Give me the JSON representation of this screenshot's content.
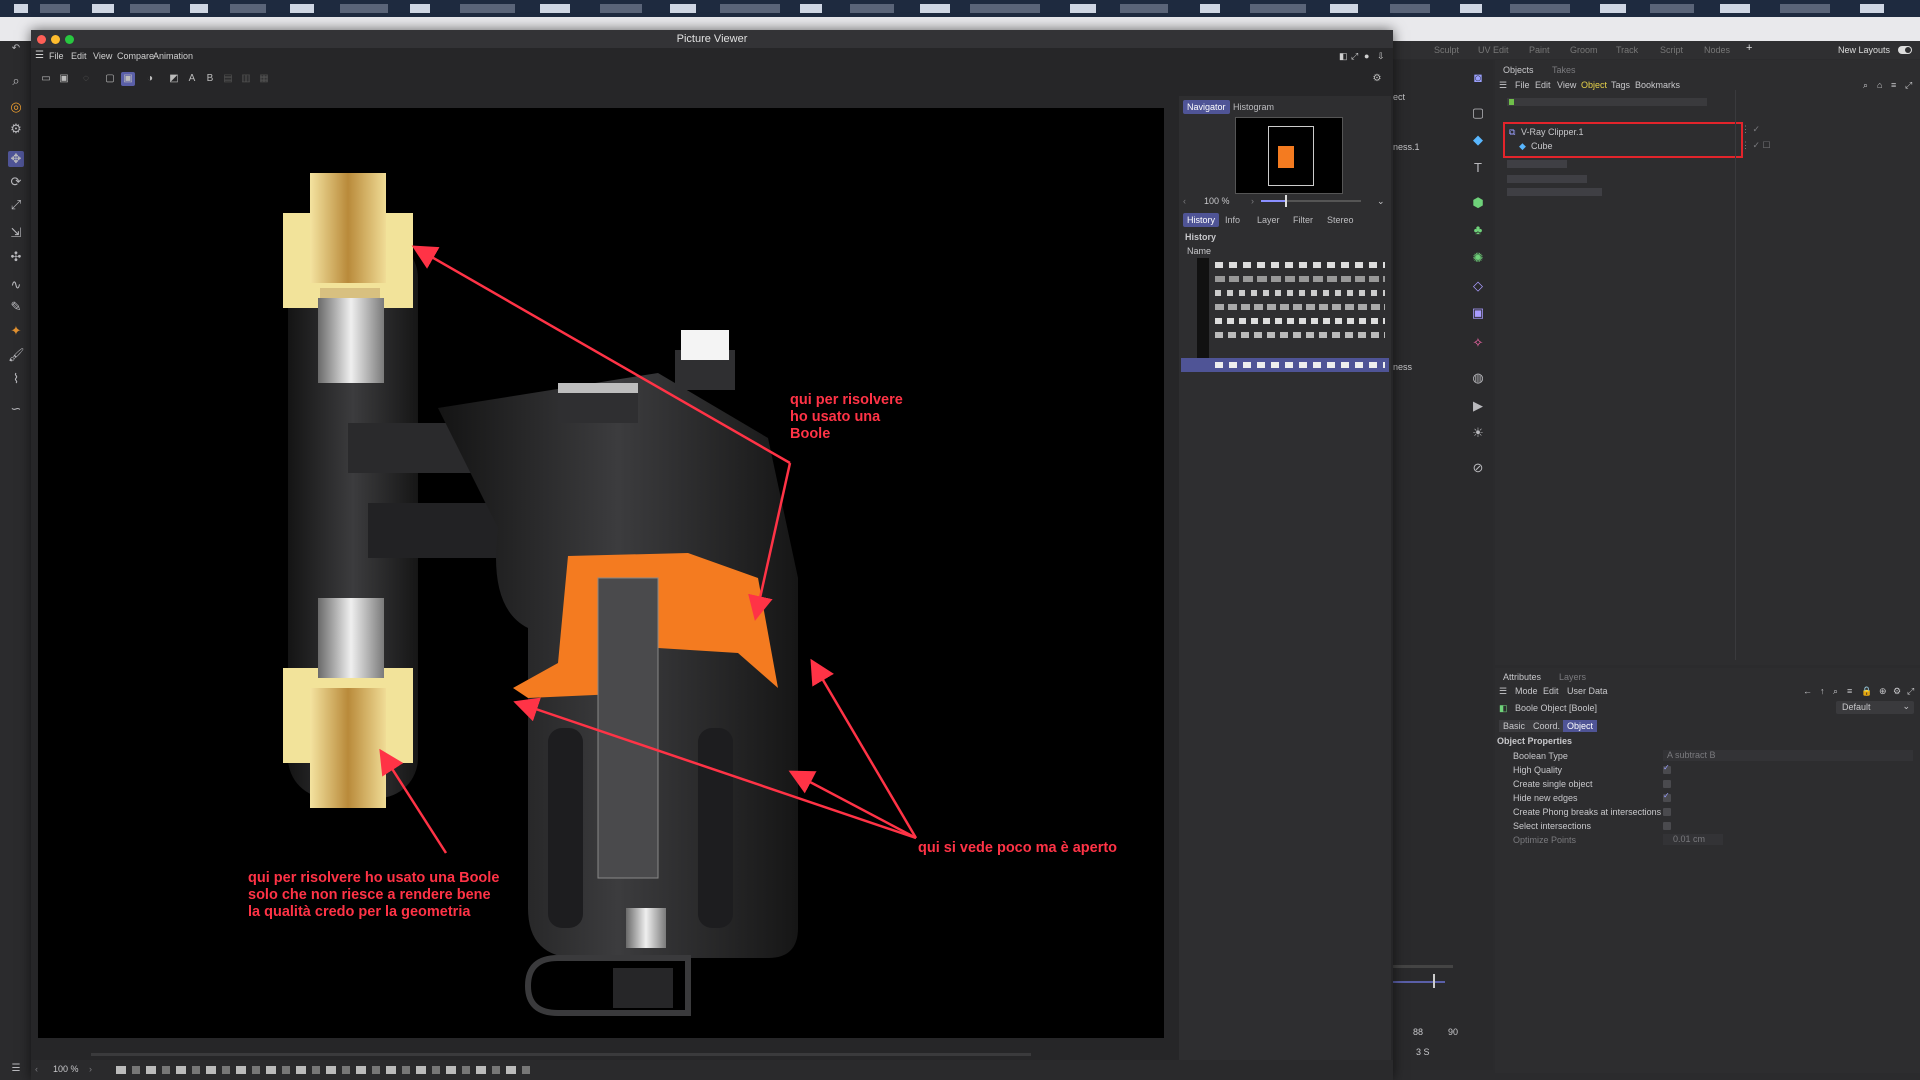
{
  "window": {
    "title": "Picture Viewer"
  },
  "menu": [
    "File",
    "Edit",
    "View",
    "Compare",
    "Animation"
  ],
  "navigator": {
    "tabs": [
      "Navigator",
      "Histogram"
    ],
    "zoom": "100 %",
    "subtabs": [
      "History",
      "Info",
      "Layer",
      "Filter",
      "Stereo"
    ],
    "history_title": "History",
    "column_name": "Name"
  },
  "annotations": {
    "top_right": "qui per risolvere\nho usato una\nBoole",
    "bottom_left": "qui per risolvere ho usato una Boole\nsolo che non riesce a rendere bene\nla qualità credo per la geometria",
    "right": "qui si vede poco ma è aperto"
  },
  "status": {
    "zoom": "100 %"
  },
  "layoutbar": {
    "items": [
      "Sculpt",
      "UV Edit",
      "Paint",
      "Groom",
      "Track",
      "Script",
      "Nodes"
    ],
    "new_layouts": "New Layouts"
  },
  "left_fragments": {
    "a": "ect",
    "b": "ness.1",
    "c": "ness"
  },
  "objects": {
    "tabs": [
      "Objects",
      "Takes"
    ],
    "menu": [
      "File",
      "Edit",
      "View",
      "Object",
      "Tags",
      "Bookmarks"
    ],
    "active_menu": "Object",
    "items": [
      "V-Ray Clipper.1",
      "Cube"
    ]
  },
  "attributes": {
    "tabs": [
      "Attributes",
      "Layers"
    ],
    "menu": [
      "Mode",
      "Edit",
      "User Data"
    ],
    "object": "Boole Object [Boole]",
    "preset": "Default",
    "subtabs": [
      "Basic",
      "Coord.",
      "Object"
    ],
    "section": "Object Properties",
    "props": [
      {
        "label": "Boolean Type",
        "value": "A subtract B",
        "kind": "select"
      },
      {
        "label": "High Quality",
        "kind": "check",
        "checked": true
      },
      {
        "label": "Create single object",
        "kind": "check",
        "checked": false
      },
      {
        "label": "Hide new edges",
        "kind": "check",
        "checked": true
      },
      {
        "label": "Create Phong breaks at intersections",
        "kind": "check",
        "checked": false
      },
      {
        "label": "Select intersections",
        "kind": "check",
        "checked": false
      },
      {
        "label": "Optimize Points",
        "value": "0.01 cm",
        "kind": "field"
      }
    ]
  },
  "timeline": {
    "frame_a": "88",
    "frame_b": "90",
    "current": "3 S"
  },
  "colors": {
    "accent": "#5a5fa8",
    "annotation": "#ff3346",
    "highlight_box": "#e3242b",
    "orange": "#f47b20"
  }
}
